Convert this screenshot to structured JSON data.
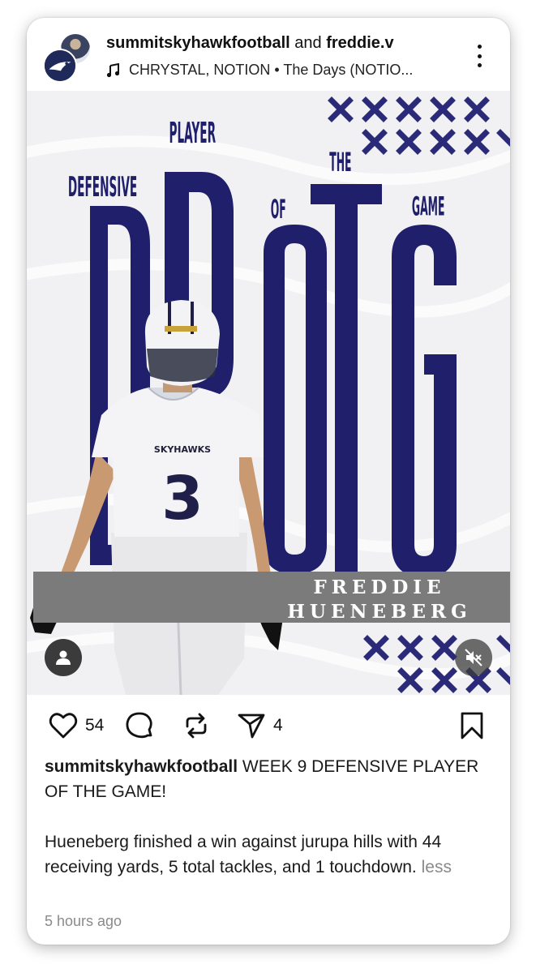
{
  "header": {
    "account_primary": "summitskyhawkfootball",
    "conjunction": " and ",
    "account_collab": "freddie.v",
    "audio": "CHRYSTAL, NOTION • The Days (NOTIO..."
  },
  "graphic": {
    "label_defensive": "DEFENSIVE",
    "label_player": "PLAYER",
    "label_of": "OF",
    "label_the": "THE",
    "label_game": "GAME",
    "big_letters": "DPOTG",
    "jersey_team": "SKYHAWKS",
    "jersey_number": "3",
    "player_first": "FREDDIE",
    "player_last": "HUENEBERG",
    "accent_color": "#1f1f6b"
  },
  "actions": {
    "likes": "54",
    "shares": "4"
  },
  "caption": {
    "user": "summitskyhawkfootball",
    "headline": " WEEK 9 DEFENSIVE PLAYER OF THE GAME!",
    "body": "Hueneberg finished a win against jurupa hills with 44 receiving yards, 5 total tackles, and 1 touchdown.",
    "less": " less"
  },
  "timestamp": "5 hours ago",
  "icons": [
    "music-note-icon",
    "more-vertical-icon",
    "user-tag-icon",
    "mute-icon",
    "heart-icon",
    "comment-icon",
    "repost-icon",
    "send-icon",
    "bookmark-icon"
  ]
}
